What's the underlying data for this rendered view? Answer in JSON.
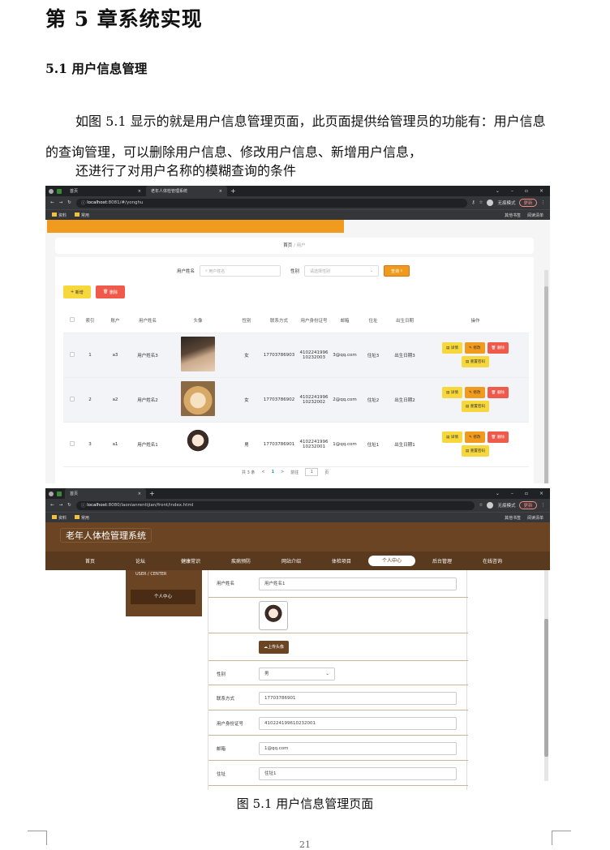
{
  "chapter_title": "第 5 章系统实现",
  "section_title": "5.1 用户信息管理",
  "paragraph1": "如图 5.1 显示的就是用户信息管理页面，此页面提供给管理员的功能有：用户信息的查询管理，可以删除用户信息、修改用户信息、新增用户信息，",
  "paragraph2": "还进行了对用户名称的模糊查询的条件",
  "caption": "图 5.1 用户信息管理页面",
  "page_number": "21",
  "browser1": {
    "tab1": "首页",
    "tab2": "老年人体检管理系统",
    "url_host": "localhost",
    "url_rest": ":8081/#/yonghu",
    "incognito": "无痕模式",
    "update": "更新",
    "bookmark1": "资料",
    "bookmark2": "常用",
    "bm_right1": "其他书签",
    "bm_right2": "阅读清单"
  },
  "admin": {
    "breadcrumb_home": "首页",
    "breadcrumb_sep": "/",
    "breadcrumb_current": "用户",
    "search_label_name": "用户姓名",
    "search_placeholder_name": "用户姓名",
    "search_label_gender": "性别",
    "search_placeholder_gender": "请选择性别",
    "search_button": "查询",
    "add_button": "新增",
    "delete_button": "删除",
    "columns": [
      "索引",
      "账户",
      "用户姓名",
      "头像",
      "性别",
      "联系方式",
      "用户身份证号",
      "邮箱",
      "住址",
      "出生日期",
      "操作"
    ],
    "rows": [
      {
        "index": "1",
        "account": "a3",
        "name": "用户姓名3",
        "gender": "女",
        "phone": "17703786903",
        "idcard": "410224199610232003",
        "email": "3@qq.com",
        "address": "住址3",
        "birth": "出生日期3"
      },
      {
        "index": "2",
        "account": "a2",
        "name": "用户姓名2",
        "gender": "女",
        "phone": "17703786902",
        "idcard": "410224199610232002",
        "email": "2@qq.com",
        "address": "住址2",
        "birth": "出生日期2"
      },
      {
        "index": "3",
        "account": "a1",
        "name": "用户姓名1",
        "gender": "男",
        "phone": "17703786901",
        "idcard": "410224199610232001",
        "email": "1@qq.com",
        "address": "住址1",
        "birth": "出生日期1"
      }
    ],
    "op_detail": "详情",
    "op_edit": "修改",
    "op_delete": "删除",
    "op_reset": "重置密码",
    "pager_total": "共 3 条",
    "pager_prev": "<",
    "pager_current": "1",
    "pager_next": ">",
    "pager_goto": "前往",
    "pager_value": "1",
    "pager_page": "页"
  },
  "browser2": {
    "tab1": "首页",
    "url_host": "localhost",
    "url_rest": ":8080/laonianrentijian/front/index.html",
    "incognito": "无痕模式",
    "update": "更新",
    "bookmark1": "资料",
    "bookmark2": "常用",
    "bm_right1": "其他书签",
    "bm_right2": "阅读清单"
  },
  "front": {
    "site_title": "老年人体检管理系统",
    "nav": [
      "首页",
      "论坛",
      "健康常识",
      "疾病预防",
      "网站介绍",
      "体检项目",
      "个人中心",
      "后台管理",
      "在线咨询"
    ],
    "nav_active_index": 6,
    "side_title": "USER / CENTER",
    "side_button": "个人中心",
    "form": {
      "name_label": "用户姓名",
      "name_value": "用户姓名1",
      "upload_button": "上传头像",
      "gender_label": "性别",
      "gender_value": "男",
      "phone_label": "联系方式",
      "phone_value": "17703786901",
      "idcard_label": "用户身份证号",
      "idcard_value": "410224199610232001",
      "email_label": "邮箱",
      "email_value": "1@qq.com",
      "address_label": "住址",
      "address_value": "住址1"
    }
  }
}
